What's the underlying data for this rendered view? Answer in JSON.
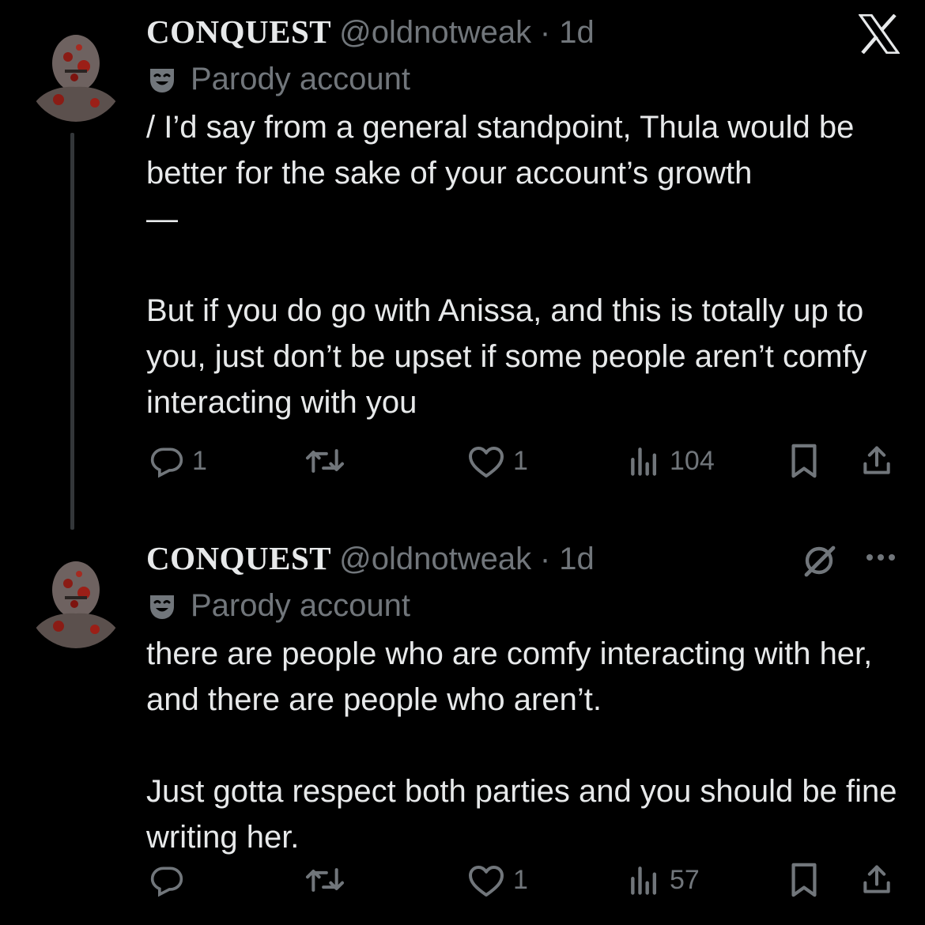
{
  "tweets": [
    {
      "name": "CONQUEST",
      "handle": "@oldnotweak",
      "time": "· 1d",
      "parody": "Parody account",
      "text": "/ I’d say from a general standpoint, Thula would be better for the sake of your account’s growth\n—\n\nBut if you do go with Anissa, and this is totally up to you, just don’t be upset if some people aren’t comfy interacting with you",
      "replies": "1",
      "retweets": "",
      "likes": "1",
      "views": "104"
    },
    {
      "name": "CONQUEST",
      "handle": "@oldnotweak",
      "time": "· 1d",
      "parody": "Parody account",
      "text": "there are people who are comfy interacting with her, and there are people who aren’t.\n\nJust gotta respect both parties and you should be fine writing her.",
      "replies": "",
      "retweets": "",
      "likes": "1",
      "views": "57"
    }
  ],
  "icons": {
    "brand": "x-logo-icon",
    "grok": "grok-icon",
    "more": "more-icon",
    "parody": "theater-mask-icon"
  },
  "colors": {
    "background": "#000000",
    "text": "#e7e9ea",
    "muted": "#71767b"
  }
}
